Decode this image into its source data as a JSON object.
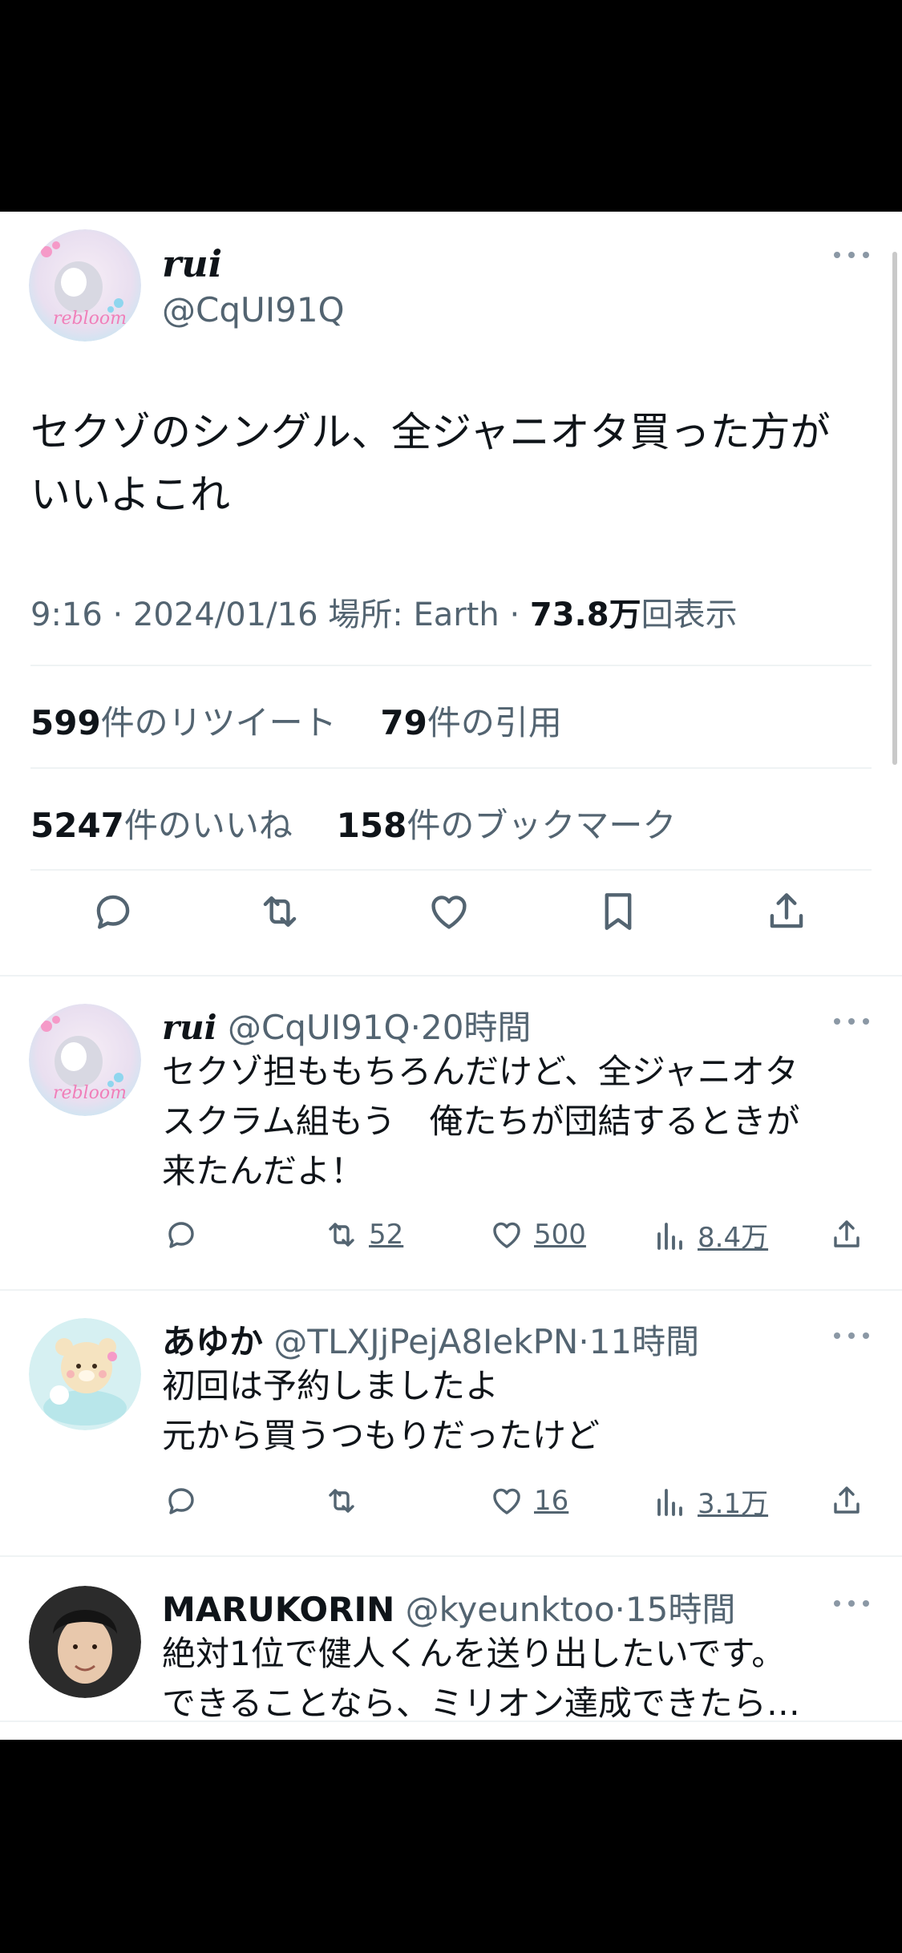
{
  "main_tweet": {
    "display_name": "rui",
    "handle": "@CqUI91Q",
    "avatar_text": "rebloom",
    "text_line1": "セクゾのシングル、全ジャニオタ買った方が",
    "text_line2": "いいよこれ",
    "time": "9:16",
    "date": "2024/01/16",
    "location": "場所: Earth",
    "views_number": "73.8万",
    "views_label": "回表示",
    "retweets_count": "599",
    "retweets_label": "件のリツイート",
    "quotes_count": "79",
    "quotes_label": "件の引用",
    "likes_count": "5247",
    "likes_label": "件のいいね",
    "bookmarks_count": "158",
    "bookmarks_label": "件のブックマーク"
  },
  "replies": [
    {
      "display_name": "rui",
      "handle": "@CqUI91Q",
      "time": "20時間",
      "avatar_text": "rebloom",
      "lines": [
        "セクゾ担ももちろんだけど、全ジャニオタ",
        "スクラム組もう　俺たちが団結するときが",
        "来たんだよ！"
      ],
      "retweets": "52",
      "likes": "500",
      "views": "8.4万"
    },
    {
      "display_name": "あゆか",
      "handle": "@TLXJjPejA8IekPN",
      "time": "11時間",
      "lines": [
        "初回は予約しましたよ",
        "元から買うつもりだったけど"
      ],
      "retweets": "",
      "likes": "16",
      "views": "3.1万"
    },
    {
      "display_name": "MARUKORIN",
      "handle": "@kyeunktoo",
      "time": "15時間",
      "lines": [
        "絶対1位で健人くんを送り出したいです。",
        "できることなら、ミリオン達成できたら…"
      ]
    }
  ],
  "colors": {
    "text": "#0f1419",
    "secondary": "#536471",
    "divider": "#eff3f4"
  },
  "icons": [
    "reply-icon",
    "retweet-icon",
    "like-icon",
    "bookmark-icon",
    "share-icon",
    "views-icon",
    "more-icon"
  ]
}
